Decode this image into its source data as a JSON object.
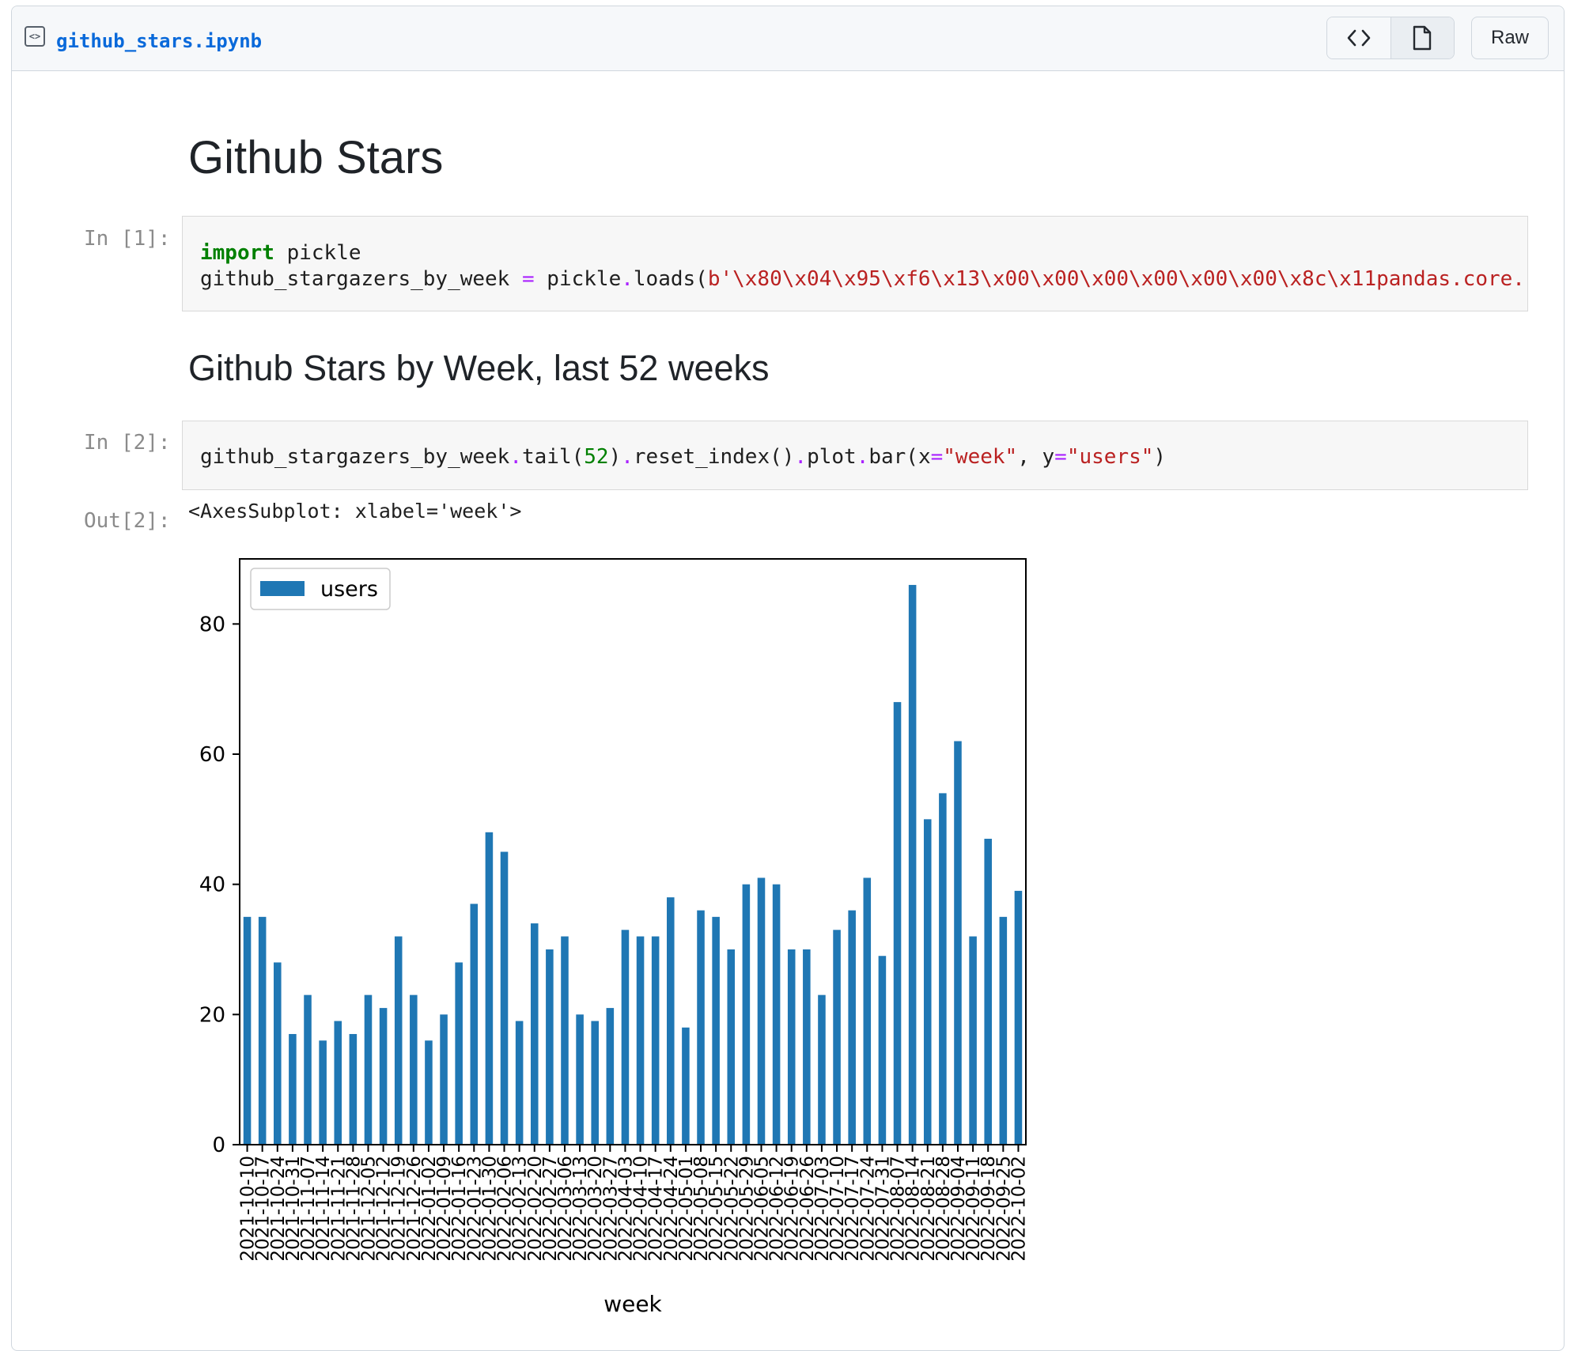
{
  "file": {
    "name": "github_stars.ipynb",
    "raw_label": "Raw"
  },
  "notebook": {
    "heading1": "Github Stars",
    "heading2": "Github Stars by Week, last 52 weeks",
    "cell1": {
      "prompt": "In [1]:",
      "line1_kw": "import",
      "line1_rest": " pickle",
      "line2_var": "github_stargazers_by_week ",
      "line2_eq": "=",
      "line2_call": " pickle",
      "line2_dot": ".",
      "line2_fn": "loads(",
      "line2_str": "b'\\x80\\x04\\x95\\xf6\\x13\\x00\\x00\\x00\\x00\\x00\\x00\\x8c\\x11pandas.core."
    },
    "cell2": {
      "prompt": "In [2]:",
      "p1": "github_stargazers_by_week",
      "p2": "tail(",
      "p3": "52",
      "p4": ")",
      "p5": "reset_index()",
      "p6": "plot",
      "p7": "bar(x",
      "p8": "\"week\"",
      "p9": ", y",
      "p10": "\"users\"",
      "p11": ")"
    },
    "out2": {
      "prompt": "Out[2]:",
      "text": "<AxesSubplot: xlabel='week'>"
    }
  },
  "chart_data": {
    "type": "bar",
    "xlabel": "week",
    "ylabel": "",
    "ylim": [
      0,
      90
    ],
    "yticks": [
      0,
      20,
      40,
      60,
      80
    ],
    "legend": {
      "placement": "upper-left",
      "entries": [
        "users"
      ]
    },
    "bar_color": "#1f77b4",
    "categories": [
      "2021-10-10",
      "2021-10-17",
      "2021-10-24",
      "2021-10-31",
      "2021-11-07",
      "2021-11-14",
      "2021-11-21",
      "2021-11-28",
      "2021-12-05",
      "2021-12-12",
      "2021-12-19",
      "2021-12-26",
      "2022-01-02",
      "2022-01-09",
      "2022-01-16",
      "2022-01-23",
      "2022-01-30",
      "2022-02-06",
      "2022-02-13",
      "2022-02-20",
      "2022-02-27",
      "2022-03-06",
      "2022-03-13",
      "2022-03-20",
      "2022-03-27",
      "2022-04-03",
      "2022-04-10",
      "2022-04-17",
      "2022-04-24",
      "2022-05-01",
      "2022-05-08",
      "2022-05-15",
      "2022-05-22",
      "2022-05-29",
      "2022-06-05",
      "2022-06-12",
      "2022-06-19",
      "2022-06-26",
      "2022-07-03",
      "2022-07-10",
      "2022-07-17",
      "2022-07-24",
      "2022-07-31",
      "2022-08-07",
      "2022-08-14",
      "2022-08-21",
      "2022-08-28",
      "2022-09-04",
      "2022-09-11",
      "2022-09-18",
      "2022-09-25",
      "2022-10-02"
    ],
    "series": [
      {
        "name": "users",
        "values": [
          35,
          35,
          28,
          17,
          23,
          16,
          19,
          17,
          23,
          21,
          32,
          23,
          16,
          20,
          28,
          37,
          48,
          45,
          19,
          34,
          30,
          32,
          20,
          19,
          21,
          33,
          32,
          32,
          38,
          18,
          36,
          35,
          30,
          40,
          41,
          40,
          30,
          30,
          23,
          33,
          36,
          41,
          29,
          68,
          86,
          50,
          54,
          62,
          32,
          47,
          35,
          39
        ]
      }
    ]
  }
}
